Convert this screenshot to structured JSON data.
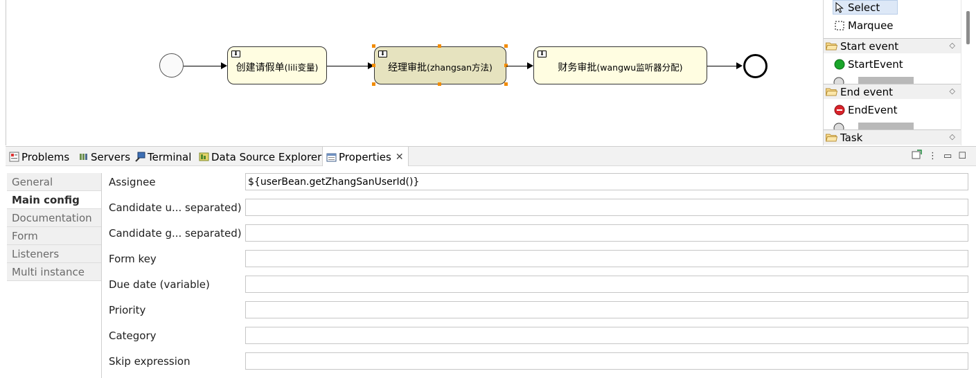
{
  "diagram": {
    "tasks": [
      {
        "label": "创建请假单",
        "label_en": "(lili变量)"
      },
      {
        "label": "经理审批",
        "label_en": "(zhangsan方法)"
      },
      {
        "label": "财务审批",
        "label_en": "(wangwu监听器分配)"
      }
    ],
    "selection_color": "#f28c00",
    "task_fill": "#fffde1",
    "selected_task_fill": "#e6e3bf"
  },
  "palette": {
    "tools": [
      {
        "label": "Select",
        "icon": "arrow-cursor-icon"
      },
      {
        "label": "Marquee",
        "icon": "marquee-icon"
      }
    ],
    "groups": [
      {
        "label": "Start event",
        "items": [
          {
            "label": "StartEvent",
            "icon": "green-circle-icon",
            "color": "#1aa52a"
          }
        ]
      },
      {
        "label": "End event",
        "items": [
          {
            "label": "EndEvent",
            "icon": "red-stop-icon",
            "color": "#d9232a"
          }
        ]
      },
      {
        "label": "Task",
        "items": []
      }
    ]
  },
  "view_tabs": [
    {
      "label": "Problems",
      "icon": "problems-icon"
    },
    {
      "label": "Servers",
      "icon": "servers-icon"
    },
    {
      "label": "Terminal",
      "icon": "terminal-icon"
    },
    {
      "label": "Data Source Explorer",
      "icon": "data-source-icon"
    },
    {
      "label": "Properties",
      "icon": "properties-icon",
      "active": true
    }
  ],
  "properties": {
    "sections": [
      "General",
      "Main config",
      "Documentation",
      "Form",
      "Listeners",
      "Multi instance"
    ],
    "active_section": "Main config",
    "fields": [
      {
        "label": "Assignee",
        "value": "${userBean.getZhangSanUserId()}"
      },
      {
        "label": "Candidate u... separated)",
        "value": ""
      },
      {
        "label": "Candidate g... separated)",
        "value": ""
      },
      {
        "label": "Form key",
        "value": ""
      },
      {
        "label": "Due date (variable)",
        "value": ""
      },
      {
        "label": "Priority",
        "value": ""
      },
      {
        "label": "Category",
        "value": ""
      },
      {
        "label": "Skip expression",
        "value": ""
      }
    ]
  }
}
